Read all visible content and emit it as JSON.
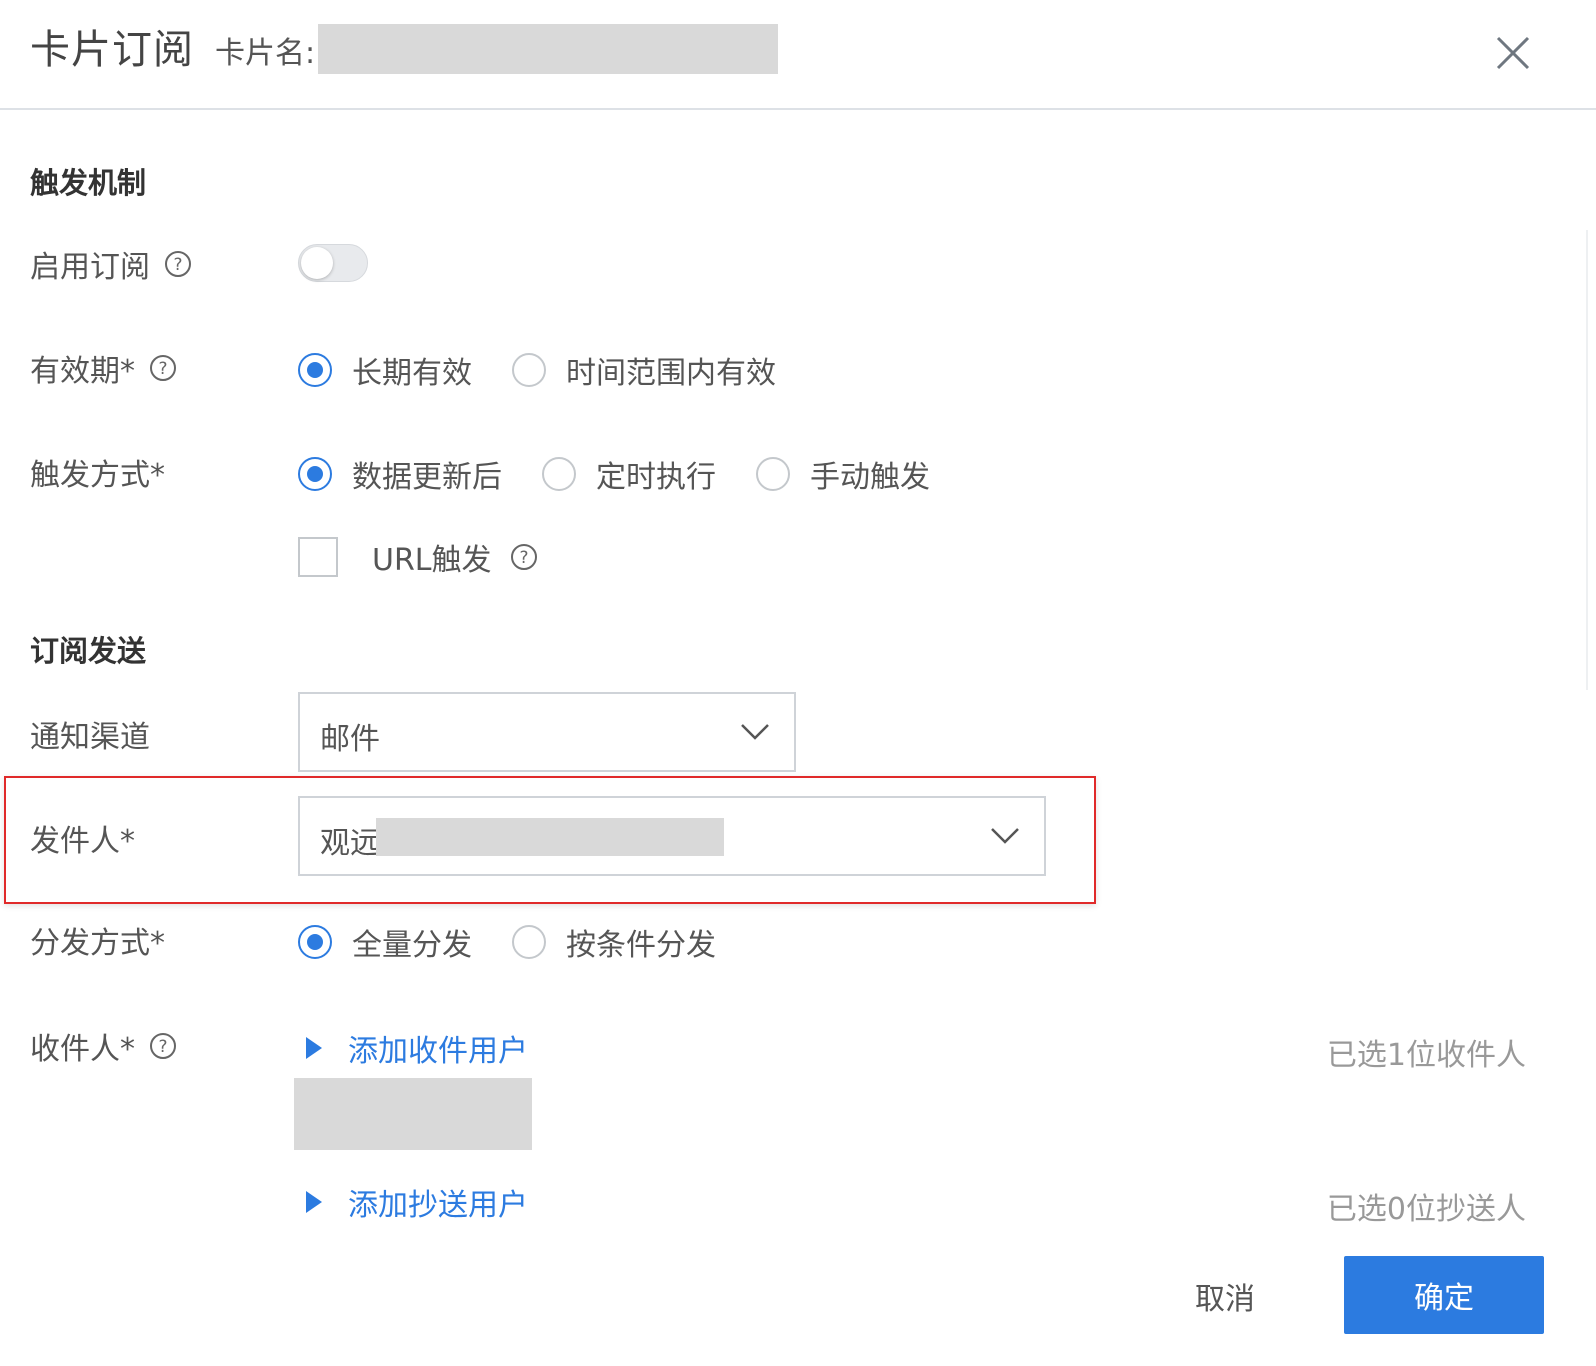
{
  "header": {
    "title": "卡片订阅",
    "card_name_label": "卡片名:",
    "close_icon": "close-icon"
  },
  "trigger_section": {
    "title": "触发机制",
    "enable_label": "启用订阅",
    "enable_value": false,
    "validity": {
      "label": "有效期*",
      "options": [
        "长期有效",
        "时间范围内有效"
      ],
      "selected": "长期有效"
    },
    "trigger_mode": {
      "label": "触发方式*",
      "options": [
        "数据更新后",
        "定时执行",
        "手动触发"
      ],
      "selected": "数据更新后",
      "url_trigger_label": "URL触发",
      "url_trigger_checked": false
    }
  },
  "send_section": {
    "title": "订阅发送",
    "channel": {
      "label": "通知渠道",
      "value": "邮件"
    },
    "sender": {
      "label": "发件人*",
      "value_prefix": "观远"
    },
    "distribution": {
      "label": "分发方式*",
      "options": [
        "全量分发",
        "按条件分发"
      ],
      "selected": "全量分发"
    },
    "recipients": {
      "label": "收件人*",
      "add_recipient_link": "添加收件用户",
      "recipient_count_text": "已选1位收件人",
      "add_cc_link": "添加抄送用户",
      "cc_count_text": "已选0位抄送人"
    }
  },
  "footer": {
    "cancel_label": "取消",
    "ok_label": "确定"
  },
  "colors": {
    "accent": "#2c7be0",
    "highlight": "#e02a2a",
    "masked": "#d9d9d9"
  }
}
